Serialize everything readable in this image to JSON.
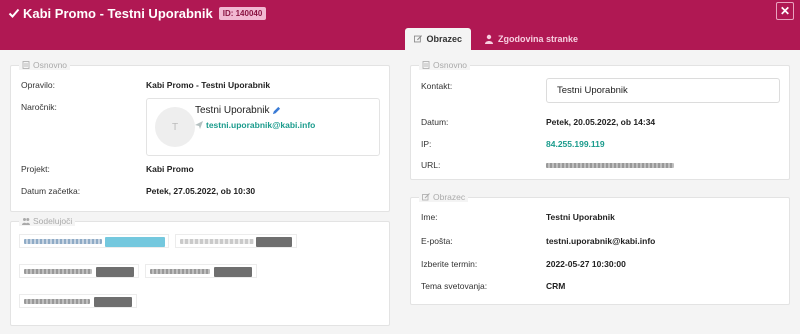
{
  "header": {
    "title": "Kabi Promo - Testni Uporabnik",
    "id_badge": "ID: 140040",
    "close_label": "✕",
    "tabs": [
      {
        "label": "Obrazec",
        "active": true,
        "icon": "edit-icon"
      },
      {
        "label": "Zgodovina stranke",
        "active": false,
        "icon": "user-icon"
      }
    ]
  },
  "left": {
    "osnovno": {
      "legend": "Osnovno",
      "rows": [
        {
          "label": "Opravilo:",
          "value": "Kabi Promo - Testni Uporabnik"
        },
        {
          "label": "Naročnik:"
        },
        {
          "label": "Projekt:",
          "value": "Kabi Promo"
        },
        {
          "label": "Datum začetka:",
          "value": "Petek, 27.05.2022, ob 10:30"
        }
      ],
      "contact": {
        "avatar_initial": "T",
        "name": "Testni Uporabnik",
        "email": "testni.uporabnik@kabi.info"
      }
    },
    "sodelujoci": {
      "legend": "Sodelujoči"
    }
  },
  "right": {
    "osnovno": {
      "legend": "Osnovno",
      "kontakt_label": "Kontakt:",
      "kontakt_value": "Testni Uporabnik",
      "datum_label": "Datum:",
      "datum_value": "Petek, 20.05.2022, ob 14:34",
      "ip_label": "IP:",
      "ip_value": "84.255.199.119",
      "url_label": "URL:"
    },
    "obrazec": {
      "legend": "Obrazec",
      "rows": [
        {
          "label": "Ime:",
          "value": "Testni Uporabnik"
        },
        {
          "label": "E-pošta:",
          "value": "testni.uporabnik@kabi.info"
        },
        {
          "label": "Izberite termin:",
          "value": "2022-05-27 10:30:00"
        },
        {
          "label": "Tema svetovanja:",
          "value": "CRM"
        }
      ]
    }
  },
  "colors": {
    "brand": "#b01853",
    "link": "#1a9b8c",
    "badge_bg": "#f2b8d2"
  }
}
